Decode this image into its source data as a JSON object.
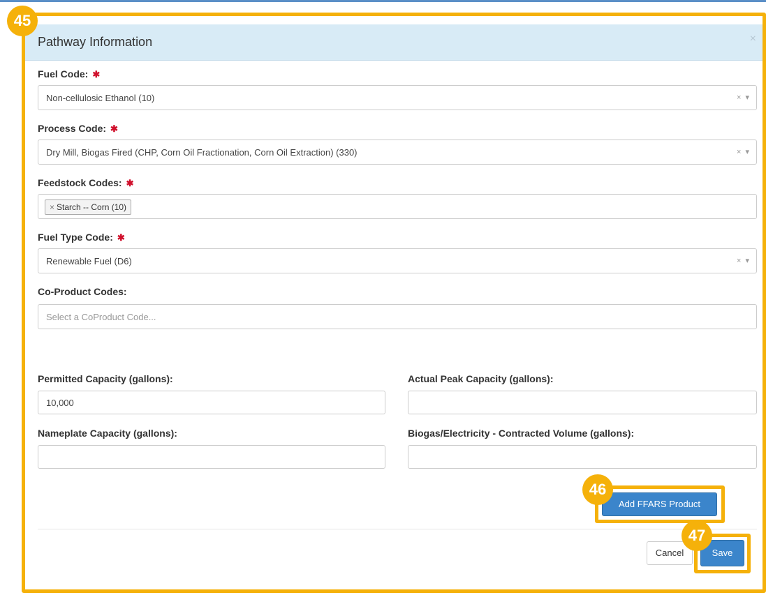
{
  "modal": {
    "title": "Pathway Information",
    "close_icon": "×"
  },
  "fields": {
    "fuel_code": {
      "label": "Fuel Code:",
      "required": "✱",
      "value": "Non-cellulosic Ethanol (10)"
    },
    "process_code": {
      "label": "Process Code:",
      "required": "✱",
      "value": "Dry Mill, Biogas Fired (CHP, Corn Oil Fractionation, Corn Oil Extraction) (330)"
    },
    "feedstock_codes": {
      "label": "Feedstock Codes:",
      "required": "✱",
      "tags": [
        "Starch -- Corn (10)"
      ],
      "tag_remove": "×"
    },
    "fuel_type_code": {
      "label": "Fuel Type Code:",
      "required": "✱",
      "value": "Renewable Fuel (D6)"
    },
    "coproduct_codes": {
      "label": "Co-Product Codes:",
      "placeholder": "Select a CoProduct Code..."
    },
    "permitted_capacity": {
      "label": "Permitted Capacity (gallons):",
      "value": "10,000"
    },
    "actual_peak_capacity": {
      "label": "Actual Peak Capacity (gallons):",
      "value": ""
    },
    "nameplate_capacity": {
      "label": "Nameplate Capacity (gallons):",
      "value": ""
    },
    "contracted_volume": {
      "label": "Biogas/Electricity - Contracted Volume (gallons):",
      "value": ""
    }
  },
  "select_controls": {
    "clear": "×",
    "arrow": "▾"
  },
  "buttons": {
    "add_ffars": "Add FFARS Product",
    "cancel": "Cancel",
    "save": "Save"
  },
  "callouts": [
    "45",
    "46",
    "47"
  ],
  "colors": {
    "header_bg": "#d8ebf6",
    "primary": "#3b85cb",
    "highlight": "#f5b10a",
    "required": "#d0102c"
  }
}
